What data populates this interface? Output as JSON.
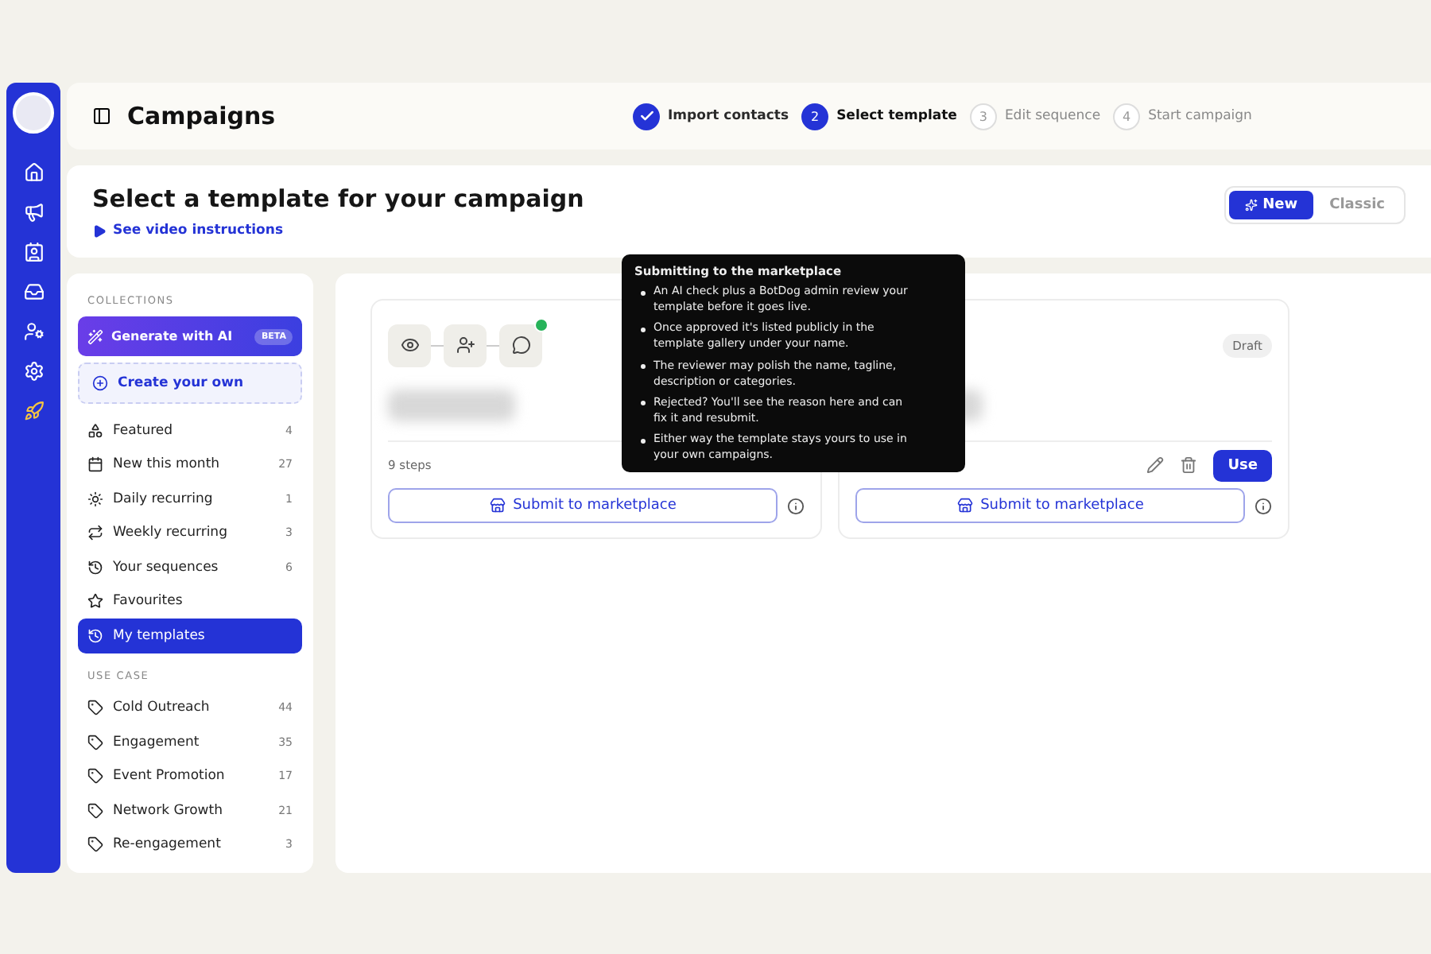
{
  "header": {
    "title": "Campaigns",
    "steps": [
      {
        "label": "Import contacts",
        "completed": true,
        "selected": false
      },
      {
        "number": "2",
        "label": "Select template",
        "completed": false,
        "selected": true
      },
      {
        "number": "3",
        "label": "Edit sequence",
        "completed": false,
        "selected": false
      },
      {
        "number": "4",
        "label": "Start campaign",
        "completed": false,
        "selected": false
      }
    ]
  },
  "intro": {
    "title": "Select a template for your campaign",
    "video_link": "See video instructions",
    "modes": [
      {
        "label": "New",
        "selected": true
      },
      {
        "label": "Classic",
        "selected": false
      }
    ]
  },
  "sidebar": {
    "collections_heading": "COLLECTIONS",
    "generate": {
      "label": "Generate with AI",
      "badge": "BETA"
    },
    "create": "Create your own",
    "collections": [
      {
        "label": "Featured",
        "count": "4",
        "selected": false
      },
      {
        "label": "New this month",
        "count": "27",
        "selected": false
      },
      {
        "label": "Daily recurring",
        "count": "1",
        "selected": false
      },
      {
        "label": "Weekly recurring",
        "count": "3",
        "selected": false
      },
      {
        "label": "Your sequences",
        "count": "6",
        "selected": false
      },
      {
        "label": "Favourites",
        "selected": false
      },
      {
        "label": "My templates",
        "selected": true
      }
    ],
    "use_case_heading": "USE CASE",
    "use_cases": [
      {
        "label": "Cold Outreach",
        "count": "44"
      },
      {
        "label": "Engagement",
        "count": "35"
      },
      {
        "label": "Event Promotion",
        "count": "17"
      },
      {
        "label": "Network Growth",
        "count": "21"
      },
      {
        "label": "Re-engagement",
        "count": "3"
      }
    ]
  },
  "cards": [
    {
      "kind": "flow",
      "steps": "9 steps",
      "submit": "Submit to marketplace"
    },
    {
      "kind": "draft",
      "badge": "Draft",
      "submit": "Submit to marketplace",
      "use_label": "Use"
    }
  ],
  "tooltip": {
    "title": "Submitting to the marketplace",
    "bullets": [
      "An AI check plus a BotDog admin review your template before it goes live.",
      "Once approved it's listed publicly in the template gallery under your name.",
      "The reviewer may polish the name, tagline, description or categories.",
      "Rejected? You'll see the reason here and can fix it and resubmit.",
      "Either way the template stays yours to use in your own campaigns."
    ]
  }
}
